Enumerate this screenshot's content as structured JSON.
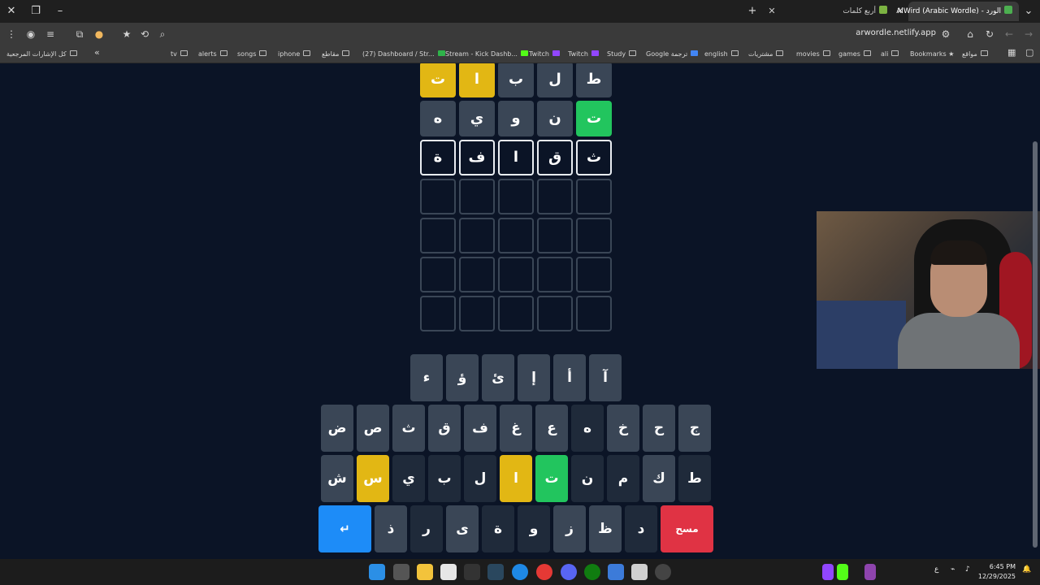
{
  "tabs": [
    {
      "title": "الورد - AlWird (Arabic Wordle)",
      "active": true
    },
    {
      "title": "أربع كلمات",
      "active": false
    }
  ],
  "url": "arwordle.netlify.app",
  "bookmarks": {
    "all_bookmarks": "كل الإشارات المرجعية",
    "items": [
      "tv",
      "alerts",
      "songs",
      "iphone",
      "مقاطع",
      "(27) Dashboard / Str...",
      "Stream - Kick Dashb...",
      "Twitch",
      "Twitch",
      "Study",
      "Google ترجمة",
      "english",
      "مشتريات",
      "movies",
      "games",
      "ali",
      "Bookmarks",
      "مواقع"
    ]
  },
  "board": {
    "rows": [
      [
        {
          "l": "ت",
          "s": "yellow"
        },
        {
          "l": "ا",
          "s": "yellow"
        },
        {
          "l": "ب",
          "s": "gray"
        },
        {
          "l": "ل",
          "s": "gray"
        },
        {
          "l": "ط",
          "s": "gray"
        }
      ],
      [
        {
          "l": "ه",
          "s": "gray"
        },
        {
          "l": "ي",
          "s": "gray"
        },
        {
          "l": "و",
          "s": "gray"
        },
        {
          "l": "ن",
          "s": "gray"
        },
        {
          "l": "ت",
          "s": "green"
        }
      ],
      [
        {
          "l": "ة",
          "s": "outline"
        },
        {
          "l": "ف",
          "s": "outline"
        },
        {
          "l": "ا",
          "s": "outline"
        },
        {
          "l": "ق",
          "s": "outline"
        },
        {
          "l": "ث",
          "s": "outline"
        }
      ],
      [
        {
          "l": "",
          "s": "empty"
        },
        {
          "l": "",
          "s": "empty"
        },
        {
          "l": "",
          "s": "empty"
        },
        {
          "l": "",
          "s": "empty"
        },
        {
          "l": "",
          "s": "empty"
        }
      ],
      [
        {
          "l": "",
          "s": "empty"
        },
        {
          "l": "",
          "s": "empty"
        },
        {
          "l": "",
          "s": "empty"
        },
        {
          "l": "",
          "s": "empty"
        },
        {
          "l": "",
          "s": "empty"
        }
      ],
      [
        {
          "l": "",
          "s": "empty"
        },
        {
          "l": "",
          "s": "empty"
        },
        {
          "l": "",
          "s": "empty"
        },
        {
          "l": "",
          "s": "empty"
        },
        {
          "l": "",
          "s": "empty"
        }
      ],
      [
        {
          "l": "",
          "s": "empty"
        },
        {
          "l": "",
          "s": "empty"
        },
        {
          "l": "",
          "s": "empty"
        },
        {
          "l": "",
          "s": "empty"
        },
        {
          "l": "",
          "s": "empty"
        }
      ]
    ]
  },
  "keyboard": {
    "rows": [
      [
        {
          "k": "ء",
          "s": "gray"
        },
        {
          "k": "ؤ",
          "s": "gray"
        },
        {
          "k": "ئ",
          "s": "gray"
        },
        {
          "k": "إ",
          "s": "gray"
        },
        {
          "k": "أ",
          "s": "gray"
        },
        {
          "k": "آ",
          "s": "gray"
        }
      ],
      [
        {
          "k": "ض",
          "s": "gray"
        },
        {
          "k": "ص",
          "s": "gray"
        },
        {
          "k": "ث",
          "s": "gray"
        },
        {
          "k": "ق",
          "s": "gray"
        },
        {
          "k": "ف",
          "s": "gray"
        },
        {
          "k": "غ",
          "s": "gray"
        },
        {
          "k": "ع",
          "s": "gray"
        },
        {
          "k": "ه",
          "s": "dark"
        },
        {
          "k": "خ",
          "s": "gray"
        },
        {
          "k": "ح",
          "s": "gray"
        },
        {
          "k": "ج",
          "s": "gray"
        }
      ],
      [
        {
          "k": "ش",
          "s": "gray"
        },
        {
          "k": "س",
          "s": "yellow"
        },
        {
          "k": "ي",
          "s": "dark"
        },
        {
          "k": "ب",
          "s": "dark"
        },
        {
          "k": "ل",
          "s": "dark"
        },
        {
          "k": "ا",
          "s": "yellow"
        },
        {
          "k": "ت",
          "s": "green"
        },
        {
          "k": "ن",
          "s": "dark"
        },
        {
          "k": "م",
          "s": "dark"
        },
        {
          "k": "ك",
          "s": "gray"
        },
        {
          "k": "ط",
          "s": "dark"
        }
      ],
      [
        {
          "k": "↵",
          "s": "enter"
        },
        {
          "k": "ذ",
          "s": "gray"
        },
        {
          "k": "ر",
          "s": "dark"
        },
        {
          "k": "ى",
          "s": "gray"
        },
        {
          "k": "ة",
          "s": "dark"
        },
        {
          "k": "و",
          "s": "dark"
        },
        {
          "k": "ز",
          "s": "gray"
        },
        {
          "k": "ظ",
          "s": "gray"
        },
        {
          "k": "د",
          "s": "dark"
        },
        {
          "k": "مسح",
          "s": "del"
        }
      ]
    ]
  },
  "taskbar": {
    "time": "6:45 PM",
    "date": "12/29/2025",
    "lang": "ع"
  },
  "colors": {
    "background": "#0b1426",
    "tile_gray": "#3a4656",
    "yellow": "#e2b714",
    "green": "#22c55e",
    "enter": "#1d8cf8",
    "delete": "#e03344"
  }
}
